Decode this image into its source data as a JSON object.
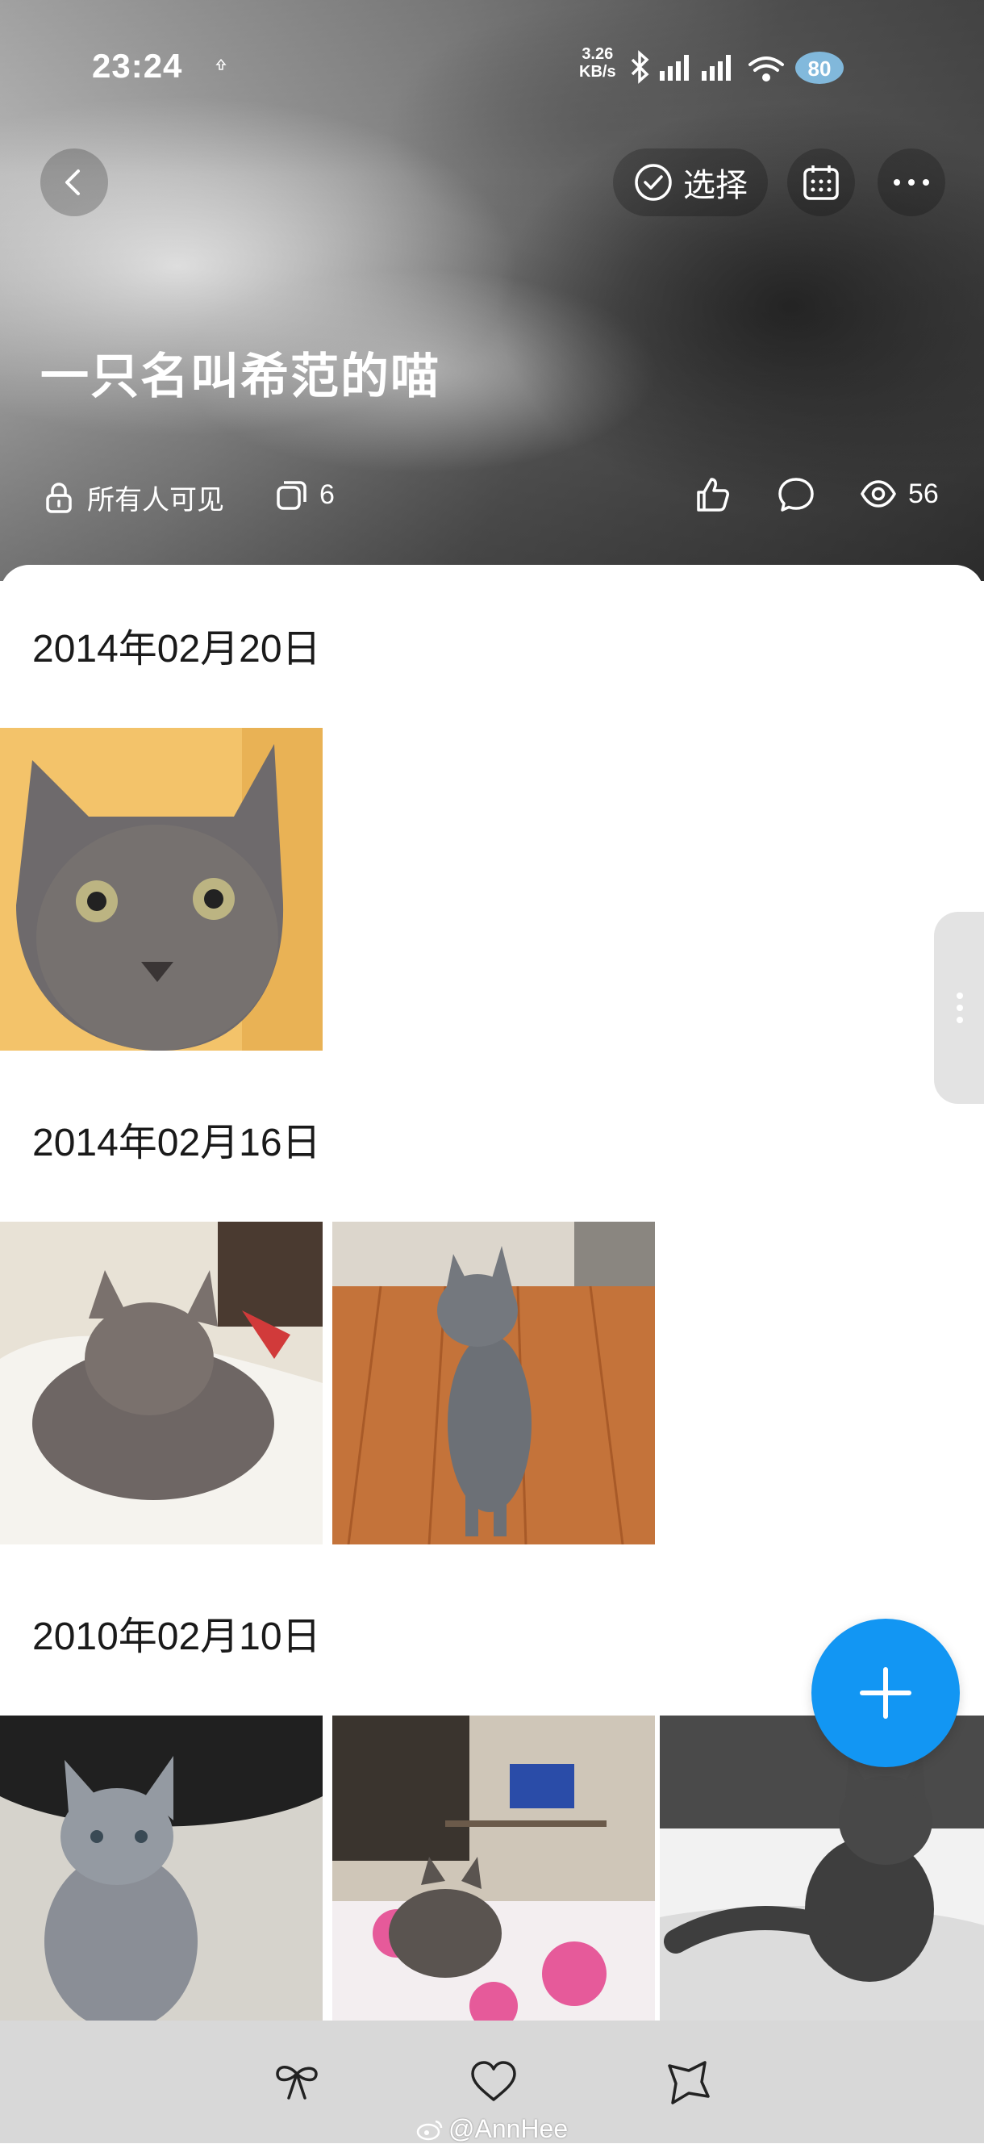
{
  "status_bar": {
    "time": "23:24",
    "net_speed_value": "3.26",
    "net_speed_unit": "KB/s",
    "battery": "80",
    "icons": [
      "bluetooth-icon",
      "signal-icon",
      "signal-icon",
      "wifi-icon",
      "battery-icon"
    ]
  },
  "header": {
    "select_label": "选择",
    "album_title": "一只名叫希范的喵",
    "privacy_label": "所有人可见",
    "photo_count": "6",
    "view_count": "56"
  },
  "groups": [
    {
      "date": "2014年02月20日",
      "photos": 1
    },
    {
      "date": "2014年02月16日",
      "photos": 2
    },
    {
      "date": "2010年02月10日",
      "photos": 3
    }
  ],
  "colors": {
    "accent": "#1296f3",
    "bottom_bar": "#d8d8d8",
    "text": "#1a1a1a"
  },
  "bottom_nav": {
    "items": [
      "bow-icon",
      "heart-icon",
      "star-icon"
    ]
  },
  "watermark": "@AnnHee"
}
